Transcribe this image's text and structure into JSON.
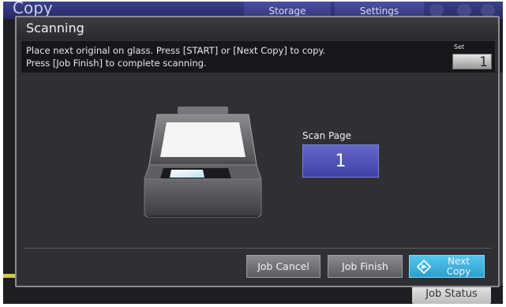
{
  "app": {
    "title": "Copy",
    "tabs": [
      "Storage",
      "Settings"
    ],
    "job_status_label": "Job Status"
  },
  "dialog": {
    "title": "Scanning",
    "message_line1": "Place next original on glass. Press [START] or [Next Copy] to copy.",
    "message_line2": "Press [Job Finish] to complete scanning.",
    "set_label": "Set",
    "set_value": "1",
    "scan_page_label": "Scan Page",
    "scan_page_value": "1",
    "buttons": {
      "job_cancel": "Job Cancel",
      "job_finish": "Job Finish",
      "next_copy_line1": "Next",
      "next_copy_line2": "Copy"
    }
  },
  "colors": {
    "accent_scan_box": "#4f52b8",
    "next_copy_button": "#3fb3df",
    "dialog_bg": "#2f3034"
  },
  "icons": {
    "scanner": "scanner-open-lid-icon",
    "next_copy": "diamond-start-icon"
  }
}
